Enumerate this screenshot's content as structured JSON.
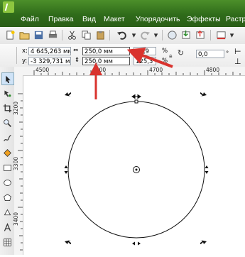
{
  "menu": {
    "items": [
      "Файл",
      "Правка",
      "Вид",
      "Макет",
      "Упорядочить",
      "Эффекты",
      "Растр"
    ]
  },
  "propbar": {
    "x_label": "x:",
    "y_label": "y:",
    "x_value": "4 645,263 мм",
    "y_value": "-3 329,731 мм",
    "width_value": "250,0 мм",
    "height_value": "250,0 мм",
    "scale_x": "94,9",
    "scale_y": "125,3",
    "pct1": "%",
    "pct2": "%",
    "rotation": "0,0"
  },
  "ruler": {
    "h_labels": [
      "4500",
      "4600",
      "4700",
      "4800"
    ],
    "v_labels": [
      "3200",
      "3300",
      "3400"
    ]
  },
  "colors": {
    "menubar": "#3a7a22",
    "arrow": "#d9332e"
  },
  "icons": {
    "toolbox": [
      "pick-tool-icon",
      "shape-tool-icon",
      "crop-tool-icon",
      "zoom-tool-icon",
      "freehand-tool-icon",
      "smart-fill-icon",
      "rectangle-tool-icon",
      "ellipse-tool-icon",
      "polygon-tool-icon",
      "basic-shapes-icon",
      "text-tool-icon",
      "table-tool-icon"
    ]
  }
}
